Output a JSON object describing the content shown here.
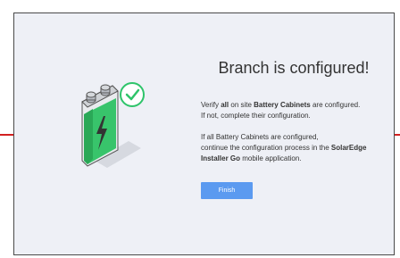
{
  "dialog": {
    "title": "Branch is configured!",
    "p1": {
      "t1": "Verify ",
      "b1": "all",
      "t2": " on site ",
      "b2": "Battery Cabinets",
      "t3": " are configured.",
      "line2": "If not, complete their configuration."
    },
    "p2": {
      "line1": "If all Battery Cabinets are configured,",
      "t1": "continue the configuration process in the ",
      "b1": "SolarEdge Installer Go",
      "t2": " mobile application."
    },
    "finish_label": "Finish"
  },
  "icons": {
    "battery": "battery-icon",
    "check": "check-circle-icon",
    "bolt": "lightning-bolt-icon"
  },
  "colors": {
    "panel_bg": "#eef0f6",
    "accent_green": "#2ec46a",
    "button_blue": "#5b9af0",
    "annotation_red": "#d22020"
  }
}
